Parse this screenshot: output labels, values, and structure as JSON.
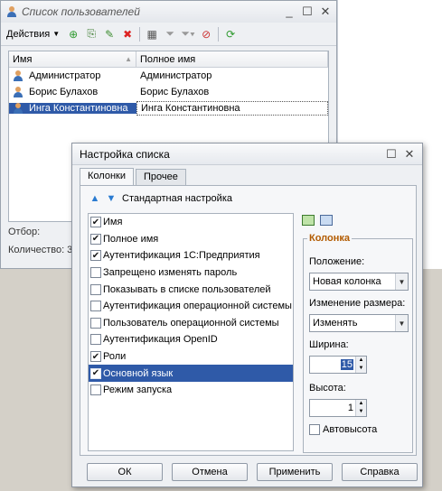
{
  "bg_window": {
    "title": "Список пользователей",
    "actions_label": "Действия",
    "columns": [
      "Имя",
      "Полное имя"
    ],
    "rows": [
      {
        "name": "Администратор",
        "full_name": "Администратор"
      },
      {
        "name": "Борис Булахов",
        "full_name": "Борис Булахов"
      },
      {
        "name": "Инга Константиновна",
        "full_name": "Инга Константиновна",
        "selected": true
      }
    ],
    "filter_label": "Отбор:",
    "count_label": "Количество: 3"
  },
  "dialog": {
    "title": "Настройка списка",
    "tabs": [
      "Колонки",
      "Прочее"
    ],
    "standard_settings_label": "Стандартная настройка",
    "columns_list": [
      {
        "label": "Имя",
        "checked": true
      },
      {
        "label": "Полное имя",
        "checked": true
      },
      {
        "label": "Аутентификация 1С:Предприятия",
        "checked": true
      },
      {
        "label": "Запрещено изменять пароль",
        "checked": false
      },
      {
        "label": "Показывать в списке пользователей",
        "checked": false
      },
      {
        "label": "Аутентификация операционной системы",
        "checked": false
      },
      {
        "label": "Пользователь операционной системы",
        "checked": false
      },
      {
        "label": "Аутентификация OpenID",
        "checked": false
      },
      {
        "label": "Роли",
        "checked": true
      },
      {
        "label": "Основной язык",
        "checked": true,
        "selected": true
      },
      {
        "label": "Режим запуска",
        "checked": false
      }
    ],
    "column_group": {
      "legend": "Колонка",
      "position_label": "Положение:",
      "position_value": "Новая колонка",
      "resize_label": "Изменение размера:",
      "resize_value": "Изменять",
      "width_label": "Ширина:",
      "width_value": "15",
      "height_label": "Высота:",
      "height_value": "1",
      "autoheight_label": "Автовысота"
    },
    "buttons": {
      "ok": "ОК",
      "cancel": "Отмена",
      "apply": "Применить",
      "help": "Справка"
    }
  }
}
